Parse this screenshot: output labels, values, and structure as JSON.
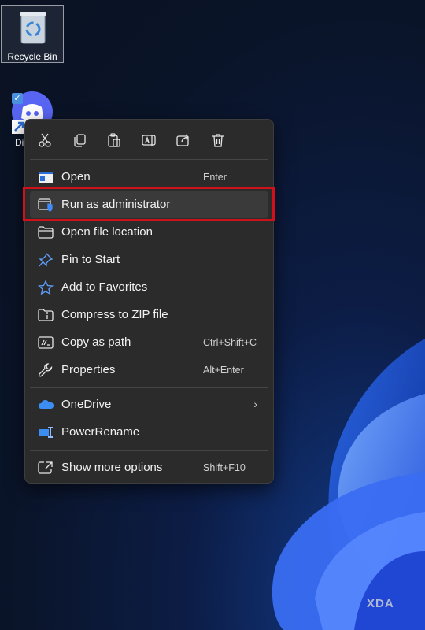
{
  "desktop": {
    "icons": [
      {
        "label": "Recycle Bin"
      },
      {
        "label": "Di"
      }
    ]
  },
  "context_menu": {
    "quick_actions": [
      "cut-icon",
      "copy-icon",
      "paste-icon",
      "rename-icon",
      "share-icon",
      "delete-icon"
    ],
    "items": [
      {
        "label": "Open",
        "shortcut": "Enter",
        "icon": "open-app-icon"
      },
      {
        "label": "Run as administrator",
        "shortcut": "",
        "icon": "shield-admin-icon"
      },
      {
        "label": "Open file location",
        "shortcut": "",
        "icon": "folder-icon"
      },
      {
        "label": "Pin to Start",
        "shortcut": "",
        "icon": "pin-icon"
      },
      {
        "label": "Add to Favorites",
        "shortcut": "",
        "icon": "star-icon"
      },
      {
        "label": "Compress to ZIP file",
        "shortcut": "",
        "icon": "zip-folder-icon"
      },
      {
        "label": "Copy as path",
        "shortcut": "Ctrl+Shift+C",
        "icon": "copy-path-icon"
      },
      {
        "label": "Properties",
        "shortcut": "Alt+Enter",
        "icon": "wrench-icon"
      },
      {
        "label": "OneDrive",
        "shortcut": "",
        "icon": "onedrive-cloud-icon"
      },
      {
        "label": "PowerRename",
        "shortcut": "",
        "icon": "powerrename-icon"
      },
      {
        "label": "Show more options",
        "shortcut": "Shift+F10",
        "icon": "expand-icon"
      }
    ],
    "highlighted_item": "Run as administrator",
    "highlight_color": "#d0101a"
  },
  "watermark": {
    "text": "XDA"
  }
}
